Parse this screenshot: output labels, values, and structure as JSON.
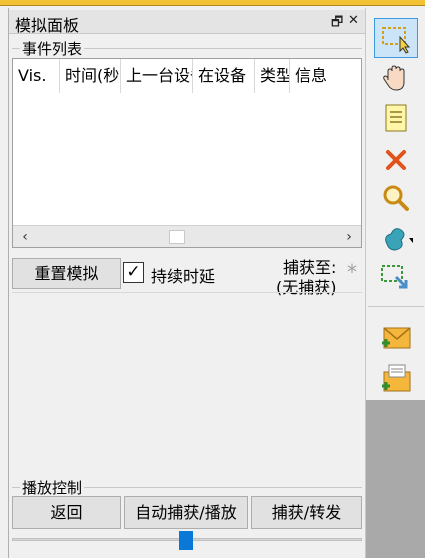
{
  "panel": {
    "title": "模拟面板",
    "float_icon": "restore-icon",
    "close_icon": "close-icon"
  },
  "event_list": {
    "group_label": "事件列表",
    "columns": [
      "Vis.",
      "时间(秒)",
      "上一台设备",
      "在设备",
      "类型",
      "信息"
    ],
    "scroll_left": "‹",
    "scroll_right": "›"
  },
  "controls": {
    "reset_label": "重置模拟",
    "continuous_label": "持续时延",
    "continuous_checked": true,
    "capture_to_label": "捕获至:",
    "capture_value": "(无捕获)",
    "star": "*"
  },
  "playback": {
    "group_label": "播放控制",
    "back_label": "返回",
    "auto_label": "自动捕获/播放",
    "capture_forward_label": "捕获/转发",
    "slider_fraction": 0.5
  },
  "toolbar": {
    "tools": [
      "select-icon",
      "move-hand-icon",
      "note-icon",
      "delete-icon",
      "inspect-icon",
      "shape-icon",
      "resize-icon",
      "add-simple-pdu-icon",
      "add-complex-pdu-icon"
    ]
  },
  "colors": {
    "accent": "#0a78d7",
    "topbar": "#f3c234"
  }
}
